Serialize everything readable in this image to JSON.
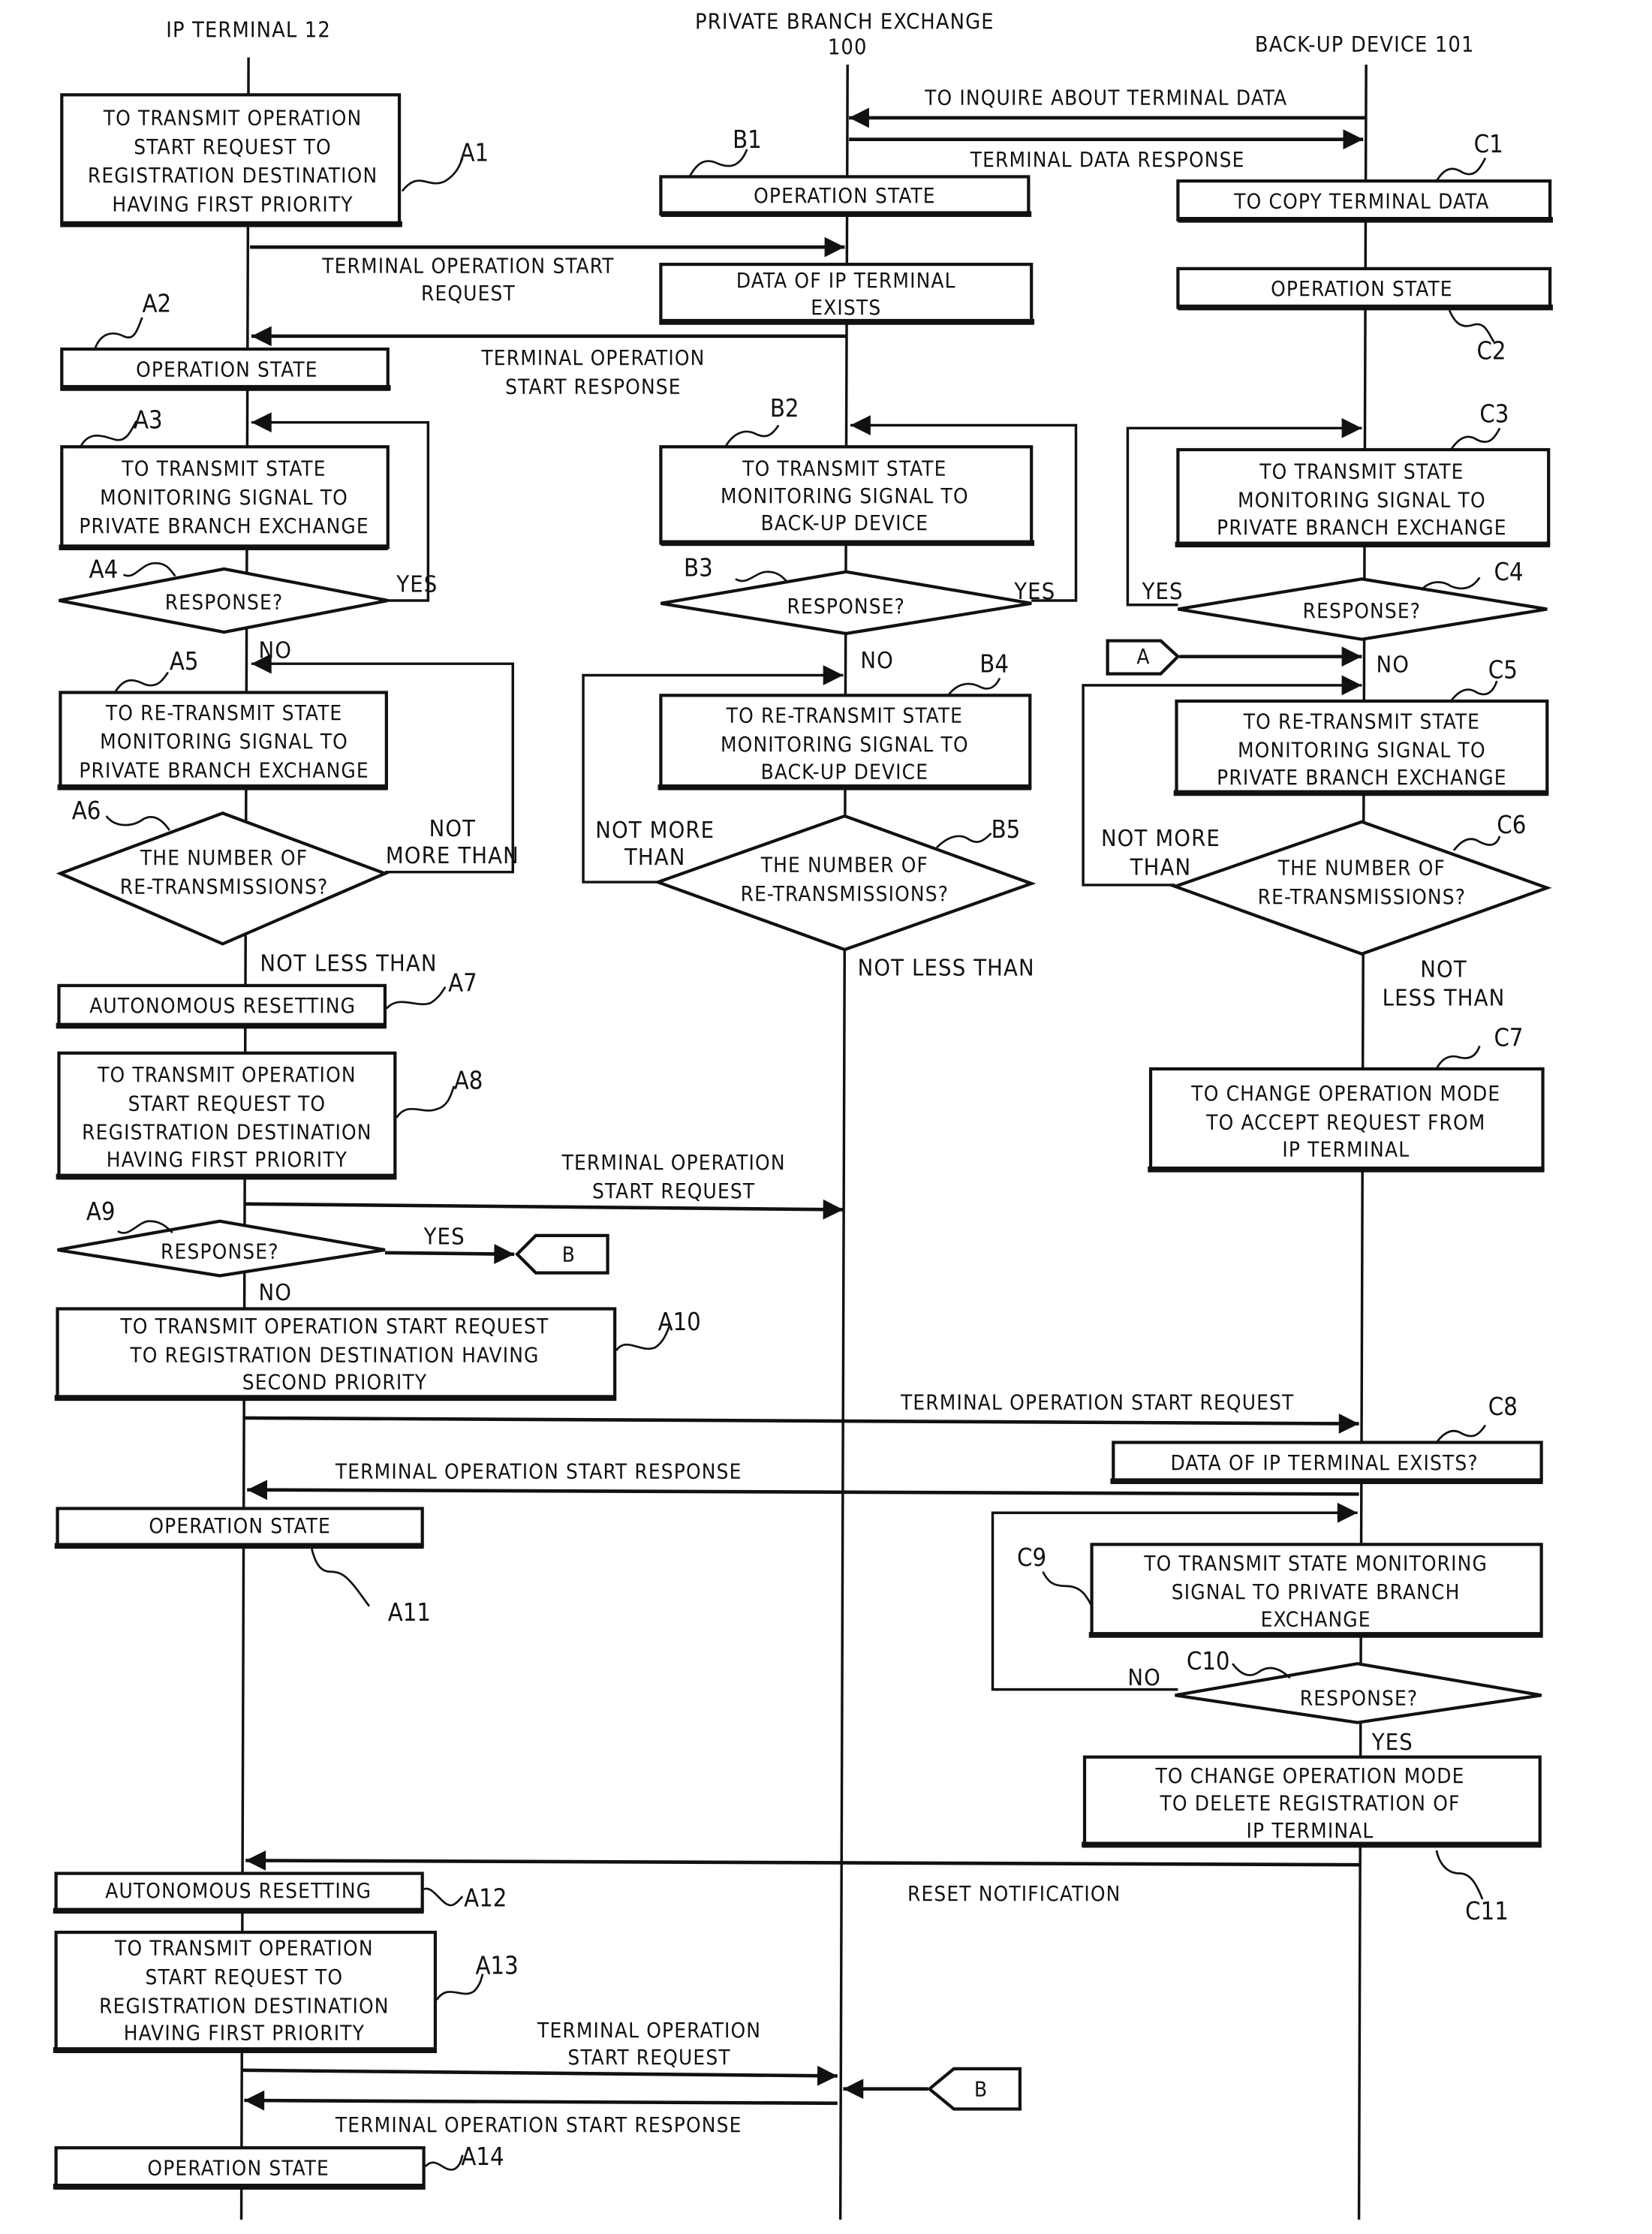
{
  "lanes": {
    "ip_terminal": "IP TERMINAL 12",
    "pbx": [
      "PRIVATE BRANCH EXCHANGE",
      "100"
    ],
    "backup": "BACK-UP DEVICE 101"
  },
  "messages": {
    "inquire": [
      "TO INQUIRE ABOUT TERMINAL DATA"
    ],
    "data_response": [
      "TERMINAL DATA RESPONSE"
    ],
    "start_request_1": [
      "TERMINAL OPERATION START",
      "REQUEST"
    ],
    "start_response_1": [
      "TERMINAL OPERATION",
      "START RESPONSE"
    ],
    "start_request_2": [
      "TERMINAL OPERATION",
      "START REQUEST"
    ],
    "start_request_3": [
      "TERMINAL OPERATION START REQUEST"
    ],
    "start_response_3": [
      "TERMINAL OPERATION START RESPONSE"
    ],
    "reset_notification": [
      "RESET NOTIFICATION"
    ],
    "start_request_4": [
      "TERMINAL OPERATION",
      "START REQUEST"
    ],
    "start_response_4": [
      "TERMINAL OPERATION START RESPONSE"
    ]
  },
  "steps": {
    "A1": {
      "ref": "A1",
      "lines": [
        "TO TRANSMIT OPERATION",
        "START REQUEST TO",
        "REGISTRATION DESTINATION",
        "HAVING FIRST PRIORITY"
      ]
    },
    "A2": {
      "ref": "A2",
      "lines": [
        "OPERATION STATE"
      ]
    },
    "A3": {
      "ref": "A3",
      "lines": [
        "TO TRANSMIT STATE",
        "MONITORING SIGNAL TO",
        "PRIVATE BRANCH EXCHANGE"
      ]
    },
    "A4": {
      "ref": "A4",
      "lines": [
        "RESPONSE?"
      ]
    },
    "A5": {
      "ref": "A5",
      "lines": [
        "TO RE-TRANSMIT STATE",
        "MONITORING SIGNAL TO",
        "PRIVATE BRANCH EXCHANGE"
      ]
    },
    "A6": {
      "ref": "A6",
      "lines": [
        "THE NUMBER OF",
        "RE-TRANSMISSIONS?"
      ]
    },
    "A7": {
      "ref": "A7",
      "lines": [
        "AUTONOMOUS RESETTING"
      ]
    },
    "A8": {
      "ref": "A8",
      "lines": [
        "TO TRANSMIT OPERATION",
        "START REQUEST TO",
        "REGISTRATION DESTINATION",
        "HAVING FIRST PRIORITY"
      ]
    },
    "A9": {
      "ref": "A9",
      "lines": [
        "RESPONSE?"
      ]
    },
    "A10": {
      "ref": "A10",
      "lines": [
        "TO TRANSMIT OPERATION START REQUEST",
        "TO REGISTRATION DESTINATION HAVING",
        "SECOND PRIORITY"
      ]
    },
    "A11": {
      "ref": "A11",
      "lines": [
        "OPERATION STATE"
      ]
    },
    "A12": {
      "ref": "A12",
      "lines": [
        "AUTONOMOUS RESETTING"
      ]
    },
    "A13": {
      "ref": "A13",
      "lines": [
        "TO TRANSMIT OPERATION",
        "START REQUEST TO",
        "REGISTRATION DESTINATION",
        "HAVING FIRST PRIORITY"
      ]
    },
    "A14": {
      "ref": "A14",
      "lines": [
        "OPERATION STATE"
      ]
    },
    "B1": {
      "ref": "B1",
      "lines": [
        "OPERATION STATE"
      ]
    },
    "B1b": {
      "lines": [
        "DATA OF IP TERMINAL",
        "EXISTS"
      ]
    },
    "B2": {
      "ref": "B2",
      "lines": [
        "TO TRANSMIT STATE",
        "MONITORING SIGNAL TO",
        "BACK-UP DEVICE"
      ]
    },
    "B3": {
      "ref": "B3",
      "lines": [
        "RESPONSE?"
      ]
    },
    "B4": {
      "ref": "B4",
      "lines": [
        "TO RE-TRANSMIT STATE",
        "MONITORING SIGNAL TO",
        "BACK-UP DEVICE"
      ]
    },
    "B5": {
      "ref": "B5",
      "lines": [
        "THE NUMBER OF",
        "RE-TRANSMISSIONS?"
      ]
    },
    "C1": {
      "ref": "C1",
      "lines": [
        "TO COPY TERMINAL DATA"
      ]
    },
    "C2": {
      "ref": "C2",
      "lines": [
        "OPERATION STATE"
      ]
    },
    "C3": {
      "ref": "C3",
      "lines": [
        "TO TRANSMIT STATE",
        "MONITORING SIGNAL TO",
        "PRIVATE BRANCH EXCHANGE"
      ]
    },
    "C4": {
      "ref": "C4",
      "lines": [
        "RESPONSE?"
      ]
    },
    "C5": {
      "ref": "C5",
      "lines": [
        "TO RE-TRANSMIT STATE",
        "MONITORING SIGNAL TO",
        "PRIVATE BRANCH EXCHANGE"
      ]
    },
    "C6": {
      "ref": "C6",
      "lines": [
        "THE NUMBER OF",
        "RE-TRANSMISSIONS?"
      ]
    },
    "C7": {
      "ref": "C7",
      "lines": [
        "TO CHANGE OPERATION MODE",
        "TO ACCEPT REQUEST FROM",
        "IP TERMINAL"
      ]
    },
    "C8": {
      "ref": "C8",
      "lines": [
        "DATA OF IP TERMINAL EXISTS?"
      ]
    },
    "C9": {
      "ref": "C9",
      "lines": [
        "TO TRANSMIT STATE MONITORING",
        "SIGNAL TO PRIVATE BRANCH",
        "EXCHANGE"
      ]
    },
    "C10": {
      "ref": "C10",
      "lines": [
        "RESPONSE?"
      ]
    },
    "C11": {
      "ref": "C11",
      "lines": [
        "TO CHANGE OPERATION MODE",
        "TO DELETE REGISTRATION OF",
        "IP TERMINAL"
      ]
    }
  },
  "branch_labels": {
    "yes": "YES",
    "no": "NO",
    "not_more_than": [
      "NOT",
      "MORE THAN"
    ],
    "not_more_than_b": [
      "NOT MORE",
      "THAN"
    ],
    "not_less_than": "NOT LESS THAN",
    "not_less_than_c": [
      "NOT",
      "LESS THAN"
    ]
  },
  "connectors": {
    "A": "A",
    "B": "B"
  }
}
